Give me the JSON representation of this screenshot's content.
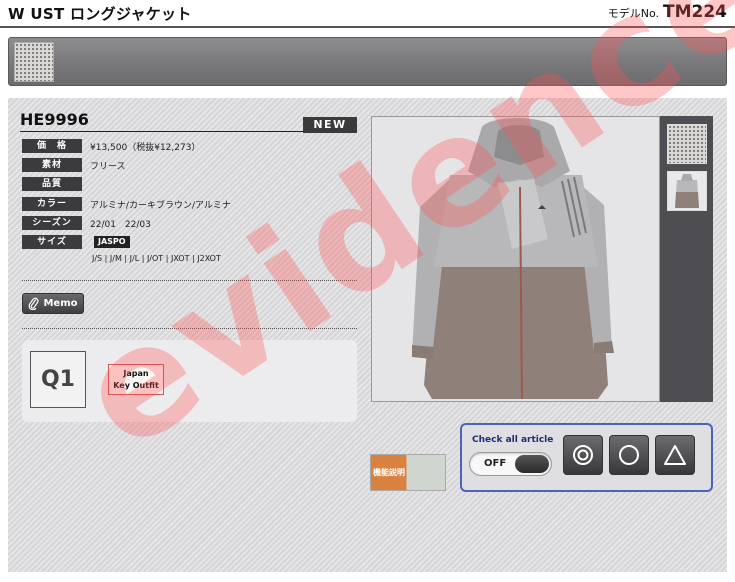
{
  "header": {
    "title": "W UST ロングジャケット",
    "model_label": "モデルNo.",
    "model_number": "TM224"
  },
  "product": {
    "article_code": "HE9996",
    "badge": "NEW",
    "specs": [
      {
        "key": "価　格",
        "value": "¥13,500（税抜¥12,273）"
      },
      {
        "key": "素材",
        "value": "フリース"
      },
      {
        "key": "品質",
        "value": ""
      },
      {
        "key": "カラー",
        "value": "アルミナ/カーキブラウン/アルミナ"
      },
      {
        "key": "シーズン",
        "value": "22/01　22/03"
      },
      {
        "key": "サイズ",
        "value": ""
      }
    ],
    "size_standard": "JASPO",
    "sizes": "J/S | J/M | J/L | J/OT | JXOT | J2XOT"
  },
  "memo_label": "Memo",
  "q_label": "Q1",
  "key_outfit_label": "Japan\nKey Outfit",
  "function_label": "機能説明",
  "check_all": {
    "label": "Check all article",
    "toggle_state": "OFF"
  },
  "watermark_text": "evidence",
  "colors": {
    "dark_key": "#3b3b3d",
    "accent_border": "#4b63b8",
    "watermark": "#ff5050",
    "jacket_upper": "#b7b7b9",
    "jacket_lower": "#8e7f78"
  }
}
